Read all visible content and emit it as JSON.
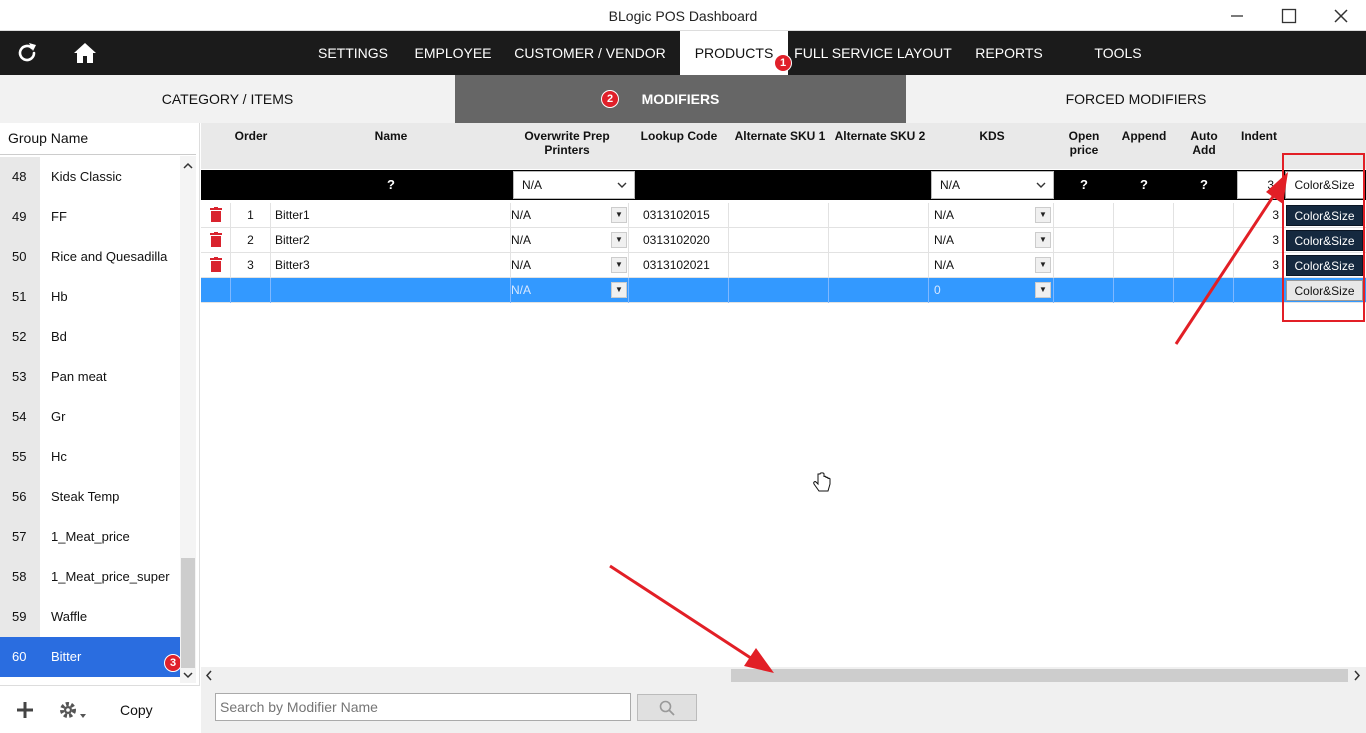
{
  "window": {
    "title": "BLogic POS Dashboard"
  },
  "nav": {
    "items": [
      {
        "label": "SETTINGS"
      },
      {
        "label": "EMPLOYEE"
      },
      {
        "label": "CUSTOMER / VENDOR"
      },
      {
        "label": "PRODUCTS"
      },
      {
        "label": "FULL SERVICE LAYOUT"
      },
      {
        "label": "REPORTS"
      },
      {
        "label": "TOOLS"
      }
    ],
    "active": "PRODUCTS"
  },
  "subtabs": {
    "items": [
      {
        "label": "CATEGORY / ITEMS"
      },
      {
        "label": "MODIFIERS"
      },
      {
        "label": "FORCED MODIFIERS"
      }
    ],
    "active": "MODIFIERS"
  },
  "badges": {
    "one": "1",
    "two": "2",
    "three": "3"
  },
  "groups": {
    "header": "Group Name",
    "items": [
      {
        "num": "48",
        "name": "Kids Classic"
      },
      {
        "num": "49",
        "name": "FF"
      },
      {
        "num": "50",
        "name": "Rice and Quesadilla"
      },
      {
        "num": "51",
        "name": "Hb"
      },
      {
        "num": "52",
        "name": "Bd"
      },
      {
        "num": "53",
        "name": "Pan meat"
      },
      {
        "num": "54",
        "name": "Gr"
      },
      {
        "num": "55",
        "name": "Hc"
      },
      {
        "num": "56",
        "name": "Steak Temp"
      },
      {
        "num": "57",
        "name": "1_Meat_price"
      },
      {
        "num": "58",
        "name": "1_Meat_price_super"
      },
      {
        "num": "59",
        "name": "Waffle"
      },
      {
        "num": "60",
        "name": "Bitter"
      }
    ],
    "selected": "60",
    "copy_label": "Copy"
  },
  "grid": {
    "headers": {
      "order": "Order",
      "name": "Name",
      "overwrite": "Overwrite Prep Printers",
      "lookup": "Lookup Code",
      "alt1": "Alternate SKU 1",
      "alt2": "Alternate SKU 2",
      "kds": "KDS",
      "open_price": "Open price",
      "append": "Append",
      "auto_add": "Auto Add",
      "indent": "Indent"
    },
    "filter": {
      "name": "?",
      "overwrite": "N/A",
      "kds": "N/A",
      "open_price": "?",
      "append": "?",
      "auto_add": "?",
      "indent": "3",
      "color_size": "Color&Size"
    },
    "rows": [
      {
        "order": "1",
        "name": "Bitter1",
        "overwrite": "N/A",
        "lookup": "0313102015",
        "alt1": "",
        "alt2": "",
        "kds": "N/A",
        "indent": "3",
        "color_size": "Color&Size"
      },
      {
        "order": "2",
        "name": "Bitter2",
        "overwrite": "N/A",
        "lookup": "0313102020",
        "alt1": "",
        "alt2": "",
        "kds": "N/A",
        "indent": "3",
        "color_size": "Color&Size"
      },
      {
        "order": "3",
        "name": "Bitter3",
        "overwrite": "N/A",
        "lookup": "0313102021",
        "alt1": "",
        "alt2": "",
        "kds": "N/A",
        "indent": "3",
        "color_size": "Color&Size"
      }
    ],
    "new_row": {
      "overwrite": "N/A",
      "kds": "0",
      "color_size": "Color&Size"
    }
  },
  "search": {
    "placeholder": "Search by Modifier Name"
  },
  "colors": {
    "accent_blue": "#3399ff",
    "selected_blue": "#2a6de0",
    "nav_dark": "#1b1b1b",
    "active_subtab": "#666666",
    "badge_red": "#e0202a",
    "annotation_red": "#e21f26",
    "delete_red": "#d9232e",
    "button_navy": "#15293f"
  }
}
